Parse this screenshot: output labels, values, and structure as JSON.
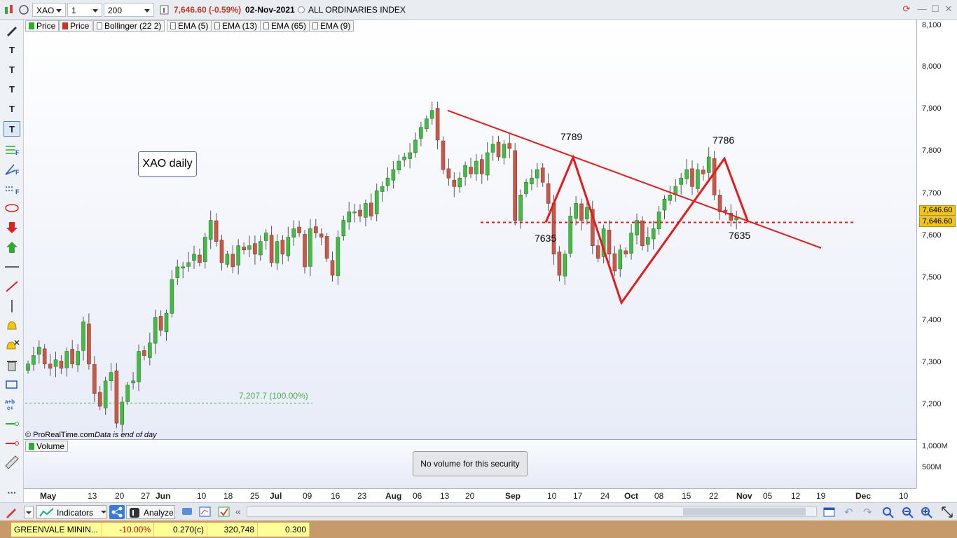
{
  "toolbar": {
    "symbol": "XAO",
    "timeframe": "1 day",
    "units": "200 units",
    "quote": "7,646.60 (-0.59%)",
    "date": "02-Nov-2021",
    "instrument": "ALL ORDINARIES INDEX",
    "icons": [
      "chart-type-icon",
      "instrument-info-icon",
      "refresh-icon",
      "minimize-icon",
      "maximize-icon",
      "close-icon"
    ]
  },
  "legend": {
    "items": [
      "Price",
      "Price",
      "Bollinger (22 2)",
      "EMA (5)",
      "EMA (13)",
      "EMA (65)",
      "EMA (9)"
    ],
    "swatch_colors": [
      "#2eaa2e",
      "#c0392b"
    ]
  },
  "chart": {
    "label_box": "XAO daily",
    "copyright": "© ProRealTime.com",
    "note": "Data is end of day",
    "fib_label": "7,207.7 (100.00%)",
    "annotations": [
      "7789",
      "7786",
      "7635",
      "7635"
    ],
    "y_ticks": [
      "8,100",
      "8,000",
      "7,900",
      "7,800",
      "7,700",
      "7,600",
      "7,500",
      "7,400",
      "7,300",
      "7,200"
    ],
    "price_tags": [
      "7,646.60",
      "7,646.60"
    ],
    "colors": {
      "up": "#44bb44",
      "down": "#c65a4a",
      "trend": "#e31b1b",
      "fib": "#4caf50"
    }
  },
  "volume": {
    "legend": "Volume",
    "message": "No volume for this security",
    "y_ticks": [
      "1,000M",
      "500M"
    ]
  },
  "x_axis": [
    {
      "t": "May",
      "b": true
    },
    {
      "t": "13"
    },
    {
      "t": "20"
    },
    {
      "t": "27"
    },
    {
      "t": "Jun",
      "b": true
    },
    {
      "t": "10"
    },
    {
      "t": "18"
    },
    {
      "t": "25"
    },
    {
      "t": "Jul",
      "b": true
    },
    {
      "t": "09"
    },
    {
      "t": "16"
    },
    {
      "t": "23"
    },
    {
      "t": "Aug",
      "b": true
    },
    {
      "t": "06"
    },
    {
      "t": "13"
    },
    {
      "t": "20"
    },
    {
      "t": "Sep",
      "b": true
    },
    {
      "t": "10"
    },
    {
      "t": "17"
    },
    {
      "t": "24"
    },
    {
      "t": "Oct",
      "b": true
    },
    {
      "t": "08"
    },
    {
      "t": "15"
    },
    {
      "t": "22"
    },
    {
      "t": "Nov",
      "b": true
    },
    {
      "t": "05"
    },
    {
      "t": "12"
    },
    {
      "t": "19"
    },
    {
      "t": "Dec",
      "b": true
    },
    {
      "t": "10"
    }
  ],
  "bottom_toolbar": {
    "indicators": "Indicators",
    "analyze": "Analyze"
  },
  "ticker": {
    "name": "GREENVALE MININ...",
    "change": "-10.00%",
    "price": "0.270(c)",
    "volume": "320,748",
    "last": "0.300"
  },
  "chart_data": {
    "type": "candlestick",
    "title": "",
    "x_range": [
      "May 2021",
      "Dec 2021"
    ],
    "ylim": [
      7150,
      8110
    ],
    "y_ticks": [
      7200,
      7300,
      7400,
      7500,
      7600,
      7700,
      7800,
      7900,
      8000,
      8100
    ],
    "last": 7646.6,
    "support_level": 7635,
    "swing_points": [
      {
        "date": "13-Aug-2021",
        "value": 7900
      },
      {
        "date": "08-Sep-2021",
        "value": 7635
      },
      {
        "date": "14-Sep-2021",
        "value": 7789
      },
      {
        "date": "28-Sep-2021",
        "value": 7445
      },
      {
        "date": "26-Oct-2021",
        "value": 7786
      },
      {
        "date": "02-Nov-2021",
        "value": 7635
      }
    ],
    "fib_level": {
      "value": 7207.7,
      "label": "7,207.7 (100.00%)"
    },
    "closes": [
      7300,
      7320,
      7340,
      7300,
      7290,
      7310,
      7290,
      7330,
      7300,
      7330,
      7400,
      7300,
      7230,
      7200,
      7260,
      7280,
      7160,
      7210,
      7250,
      7260,
      7330,
      7320,
      7350,
      7410,
      7380,
      7420,
      7500,
      7530,
      7530,
      7540,
      7560,
      7540,
      7600,
      7640,
      7590,
      7540,
      7560,
      7530,
      7580,
      7570,
      7580,
      7560,
      7590,
      7610,
      7540,
      7590,
      7560,
      7600,
      7620,
      7610,
      7530,
      7620,
      7610,
      7600,
      7550,
      7510,
      7600,
      7640,
      7660,
      7660,
      7650,
      7680,
      7650,
      7710,
      7720,
      7740,
      7760,
      7780,
      7790,
      7800,
      7830,
      7860,
      7880,
      7900,
      7830,
      7760,
      7740,
      7720,
      7740,
      7770,
      7750,
      7780,
      7750,
      7800,
      7820,
      7790,
      7820,
      7810,
      7640,
      7700,
      7730,
      7740,
      7760,
      7730,
      7680,
      7560,
      7510,
      7560,
      7650,
      7680,
      7640,
      7670,
      7580,
      7550,
      7620,
      7560,
      7520,
      7570,
      7560,
      7610,
      7640,
      7580,
      7600,
      7620,
      7660,
      7690,
      7700,
      7720,
      7740,
      7760,
      7720,
      7760,
      7750,
      7790,
      7700,
      7660,
      7660,
      7640,
      7646.6
    ]
  }
}
